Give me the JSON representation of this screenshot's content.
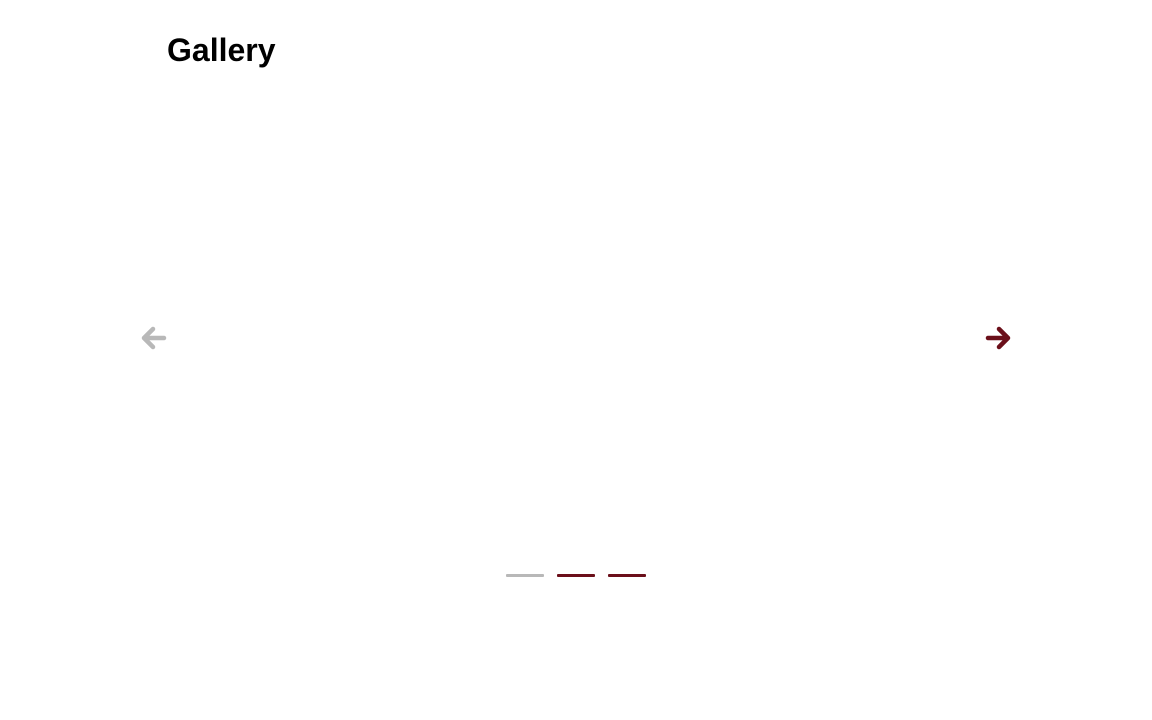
{
  "page": {
    "title": "Gallery"
  },
  "carousel": {
    "prev_icon": "arrow-left-icon",
    "next_icon": "arrow-right-icon",
    "prev_color": "#b8b8b8",
    "next_color": "#6b0f1a",
    "indicator_active_color": "#b8b8b8",
    "indicator_inactive_color": "#6b0f1a",
    "slide_count": 3,
    "current_slide": 1
  }
}
